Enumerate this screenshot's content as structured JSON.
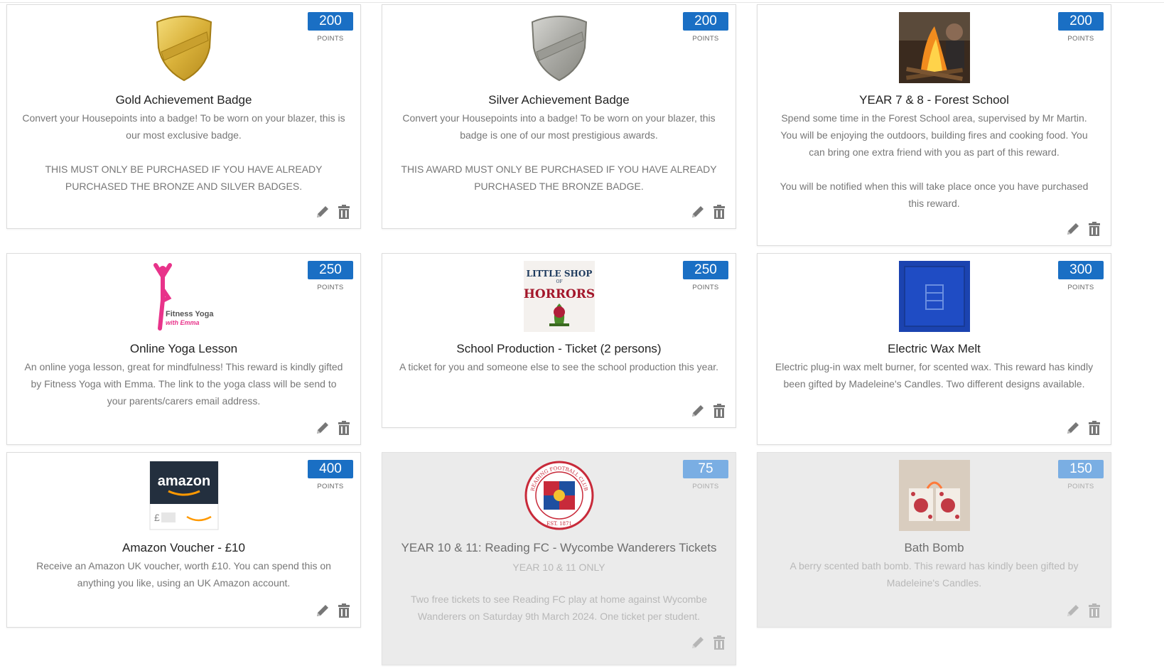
{
  "points_label": "POINTS",
  "cards": [
    {
      "title": "Gold Achievement Badge",
      "points": "200",
      "desc": "Convert your Housepoints into a badge! To be worn on your blazer, this is our most exclusive badge.\n\nTHIS MUST ONLY BE PURCHASED IF YOU HAVE ALREADY PURCHASED THE BRONZE AND SILVER BADGES.",
      "image": "gold-shield-badge"
    },
    {
      "title": "Silver Achievement Badge",
      "points": "200",
      "desc": "Convert your Housepoints into a badge! To be worn on your blazer, this badge is one of our most prestigious awards.\n\nTHIS AWARD MUST ONLY BE PURCHASED IF YOU HAVE ALREADY PURCHASED THE BRONZE BADGE.",
      "image": "silver-shield-badge"
    },
    {
      "title": "YEAR 7 & 8 - Forest School",
      "points": "200",
      "desc": "Spend some time in the Forest School area, supervised by Mr Martin. You will be enjoying the outdoors, building fires and cooking food. You can bring one extra friend with you as part of this reward.\n\nYou will be notified when this will take place once you have purchased this reward.",
      "image": "campfire-photo"
    },
    {
      "title": "Online Yoga Lesson",
      "points": "250",
      "desc": "An online yoga lesson, great for mindfulness! This reward is kindly gifted by Fitness Yoga with Emma. The link to the yoga class will be send to your parents/carers email address.",
      "image": "fitness-yoga-logo",
      "logo_text": "Fitness Yoga",
      "logo_sub": "with Emma"
    },
    {
      "title": "School Production - Ticket (2 persons)",
      "points": "250",
      "desc": "A ticket for you and someone else to see the school production this year.",
      "image": "little-shop-of-horrors-poster",
      "logo_text": "LITTLE SHOP",
      "logo_mid": "OF",
      "logo_sub": "HORRORS"
    },
    {
      "title": "Electric Wax Melt",
      "points": "300",
      "desc": "Electric plug-in wax melt burner, for scented wax. This reward has kindly been gifted by Madeleine's Candles. Two different designs available.",
      "image": "blue-wax-melt-box"
    },
    {
      "title": "Amazon Voucher - £10",
      "points": "400",
      "desc": "Receive an Amazon UK voucher, worth £10. You can spend this on anything you like, using an UK Amazon account.",
      "image": "amazon-gift-card",
      "logo_text": "amazon",
      "logo_sub": "£"
    },
    {
      "title": "YEAR 10 & 11: Reading FC - Wycombe Wanderers Tickets",
      "points": "75",
      "subtitle": "YEAR 10 & 11 ONLY",
      "desc": "Two free tickets to see Reading FC play at home against Wycombe Wanderers on Saturday 9th March 2024. One ticket per student.",
      "image": "reading-fc-crest",
      "logo_text": "READING FOOTBALL CLUB",
      "logo_sub": "EST. 1871",
      "disabled": true
    },
    {
      "title": "Bath Bomb",
      "points": "150",
      "desc": "A berry scented bath bomb. This reward has kindly been gifted by Madeleine's Candles.",
      "image": "bath-bomb-photo",
      "disabled": true
    }
  ],
  "colors": {
    "points_blue": "#1a6fc4",
    "points_blue_disabled": "#7aaee3",
    "yoga_pink": "#e8338a"
  }
}
